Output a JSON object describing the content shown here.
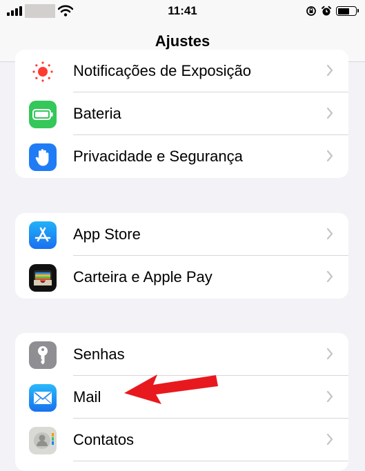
{
  "status_bar": {
    "time": "11:41"
  },
  "nav": {
    "title": "Ajustes"
  },
  "groups": [
    {
      "rows": [
        {
          "label": "Notificações de Exposição",
          "icon": "exposure-notification-icon"
        },
        {
          "label": "Bateria",
          "icon": "battery-icon"
        },
        {
          "label": "Privacidade e Segurança",
          "icon": "hand-icon"
        }
      ]
    },
    {
      "rows": [
        {
          "label": "App Store",
          "icon": "app-store-icon"
        },
        {
          "label": "Carteira e Apple Pay",
          "icon": "wallet-icon"
        }
      ]
    },
    {
      "rows": [
        {
          "label": "Senhas",
          "icon": "key-icon"
        },
        {
          "label": "Mail",
          "icon": "mail-icon"
        },
        {
          "label": "Contatos",
          "icon": "contacts-icon"
        }
      ]
    }
  ],
  "colors": {
    "accent_arrow": "#e8191e",
    "background": "#f2f2f7"
  }
}
